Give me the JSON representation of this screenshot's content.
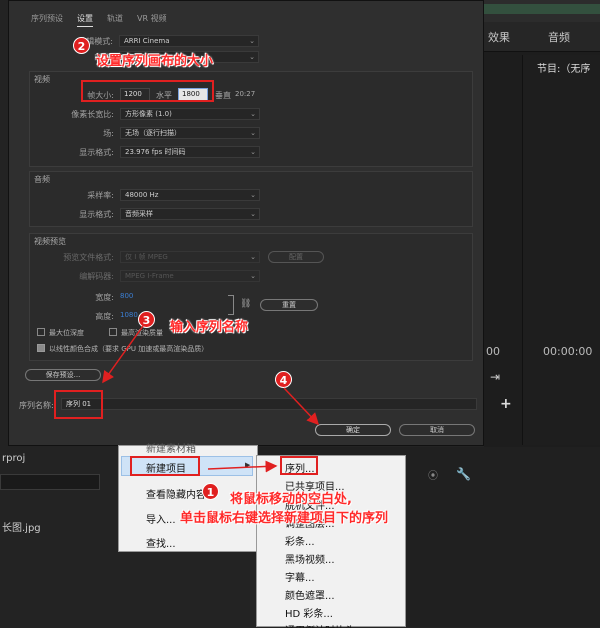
{
  "background": {
    "tabs": [
      "效果",
      "音频"
    ],
    "program_label": "节目:（无序",
    "timecode_right": "00:00:00",
    "timecode_mid": "00",
    "left_file": "rproj",
    "left_image": "长图.jpg"
  },
  "dialog": {
    "tabs": [
      "序列预设",
      "设置",
      "轨道",
      "VR 视频"
    ],
    "active_tab": "设置",
    "editing_mode": {
      "label": "编辑模式:",
      "value": "ARRI Cinema"
    },
    "timebase": {
      "label": "时基:",
      "value": ""
    },
    "video": {
      "title": "视频",
      "frame_size_label": "帧大小:",
      "width": "1200",
      "horizontal_label": "水平",
      "height": "1800",
      "vertical_label": "垂直",
      "ratio": "20:27",
      "pixel_aspect_label": "像素长宽比:",
      "pixel_aspect": "方形像素 (1.0)",
      "fields_label": "场:",
      "fields": "无场（逐行扫描）",
      "display_format_label": "显示格式:",
      "display_format": "23.976 fps 时间码"
    },
    "audio": {
      "title": "音频",
      "sample_rate_label": "采样率:",
      "sample_rate": "48000 Hz",
      "display_format_label": "显示格式:",
      "display_format": "音频采样"
    },
    "preview": {
      "title": "视频预览",
      "file_format_label": "预览文件格式:",
      "file_format": "仅 I 帧 MPEG",
      "config_button": "配置",
      "codec_label": "编解码器:",
      "codec": "MPEG I-Frame",
      "width_label": "宽度:",
      "width": "800",
      "height_label": "高度:",
      "height": "1080",
      "reset_button": "重置"
    },
    "max_bit_depth": "最大位深度",
    "max_render_quality": "最高渲染质量",
    "linear_color": "以线性颜色合成（要求 GPU 加速或最高渲染品质）",
    "save_preset": "保存预设...",
    "sequence_name_label": "序列名称:",
    "sequence_name": "序列 01",
    "ok": "确定",
    "cancel": "取消"
  },
  "context_menu": {
    "top_cut": "新建素材箱",
    "items": [
      "新建项目",
      "查看隐藏内容",
      "导入...",
      "查找..."
    ]
  },
  "submenu": {
    "items": [
      "序列...",
      "已共享项目...",
      "脱机文件...",
      "调整图层...",
      "彩条...",
      "黑场视频...",
      "字幕...",
      "颜色遮罩...",
      "HD 彩条...",
      "通用倒计时片头..."
    ]
  },
  "annotations": {
    "step1": "1",
    "step2": "2",
    "step3": "3",
    "step4": "4",
    "note2": "设置序列画布的大小",
    "note3": "输入序列名称",
    "note1_line1": "将鼠标移动的空白处,",
    "note1_line2": "单击鼠标右键选择新建项目下的序列"
  },
  "colors": {
    "annotation_red": "#e02020",
    "accent_blue": "#3b7fd4"
  }
}
